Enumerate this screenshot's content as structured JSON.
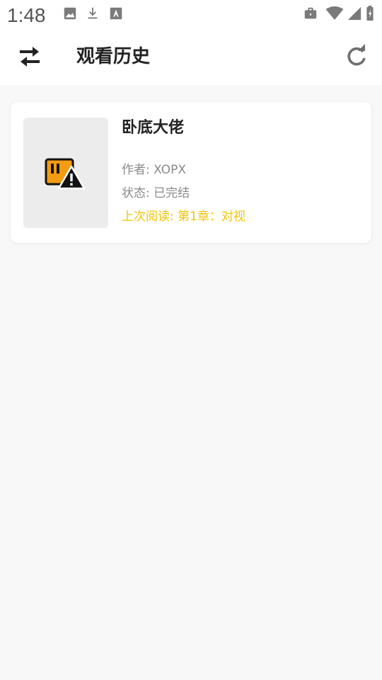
{
  "status_bar": {
    "time": "1:48",
    "left_icons": [
      "image-icon",
      "download-icon",
      "text-a-icon"
    ],
    "right_icons": [
      "briefcase-icon",
      "wifi-icon",
      "signal-icon",
      "battery-icon"
    ]
  },
  "app_bar": {
    "title": "观看历史",
    "left_icon": "swap-icon",
    "right_icon": "refresh-icon"
  },
  "history": [
    {
      "title": "卧底大佬",
      "author": "作者: XOPX",
      "status": "状态: 已完结",
      "last_read": "上次阅读: 第1章：对视",
      "cover_icon": "image-error-icon"
    }
  ],
  "colors": {
    "background": "#f8f8f8",
    "card": "#ffffff",
    "accent": "#f2c300",
    "meta_text": "#8a8a8a",
    "cover_placeholder": "#ececec"
  }
}
